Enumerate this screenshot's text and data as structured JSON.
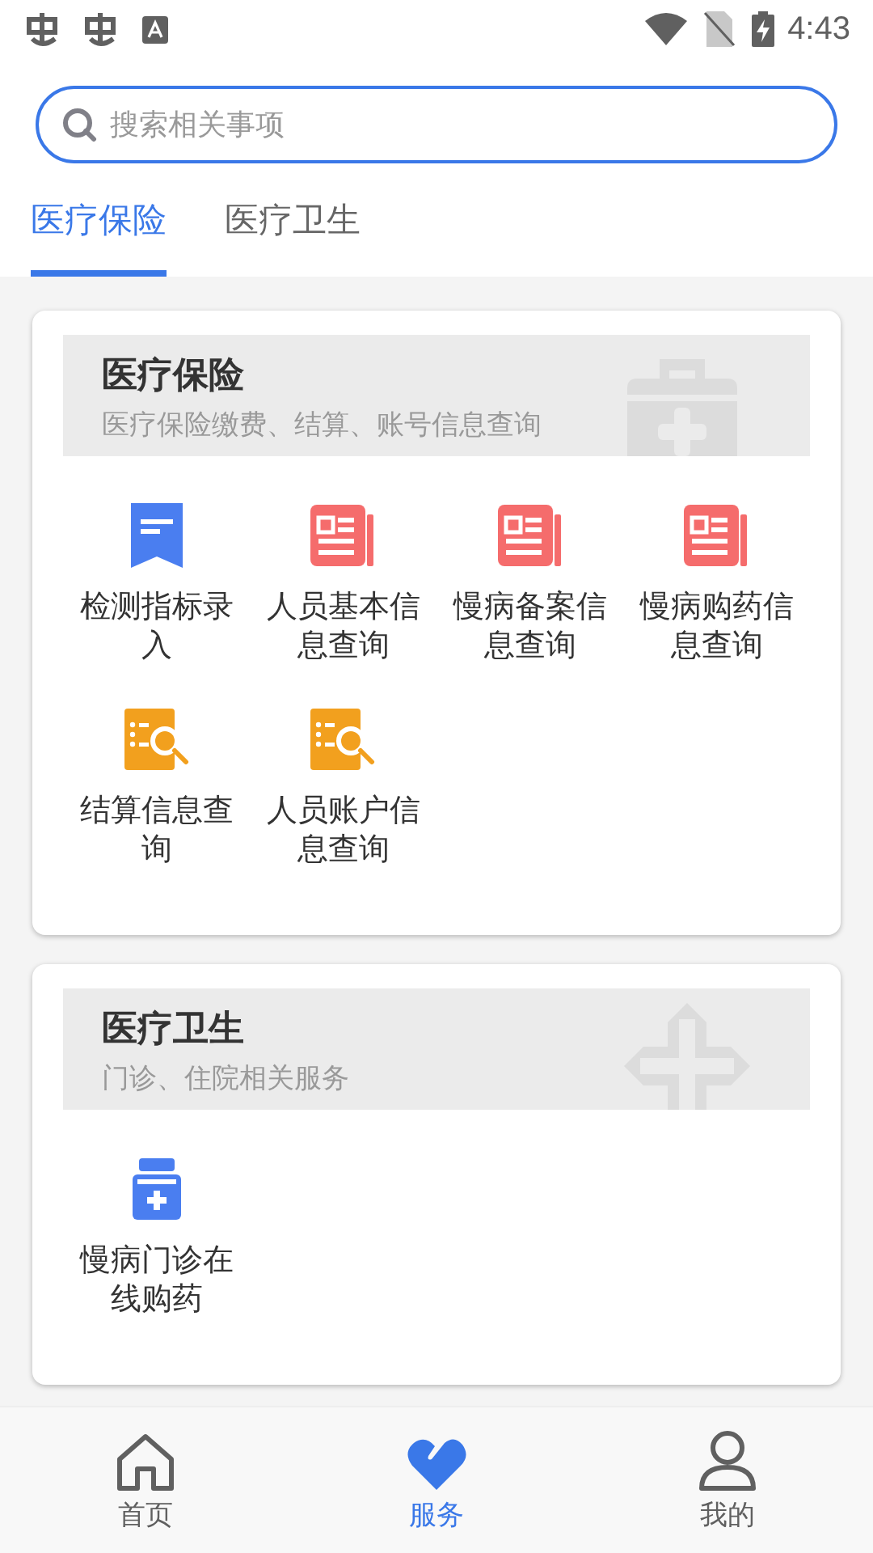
{
  "status_bar": {
    "time": "4:43"
  },
  "search": {
    "placeholder": "搜索相关事项"
  },
  "tabs": [
    {
      "label": "医疗保险",
      "selected": true
    },
    {
      "label": "医疗卫生",
      "selected": false
    }
  ],
  "sections": [
    {
      "title": "医疗保险",
      "subtitle": "医疗保险缴费、结算、账号信息查询",
      "kind": "kit",
      "items": [
        {
          "label": "检测指标录入",
          "kind": "bookmark"
        },
        {
          "label": "人员基本信息查询",
          "kind": "news"
        },
        {
          "label": "慢病备案信息查询",
          "kind": "news"
        },
        {
          "label": "慢病购药信息查询",
          "kind": "news"
        },
        {
          "label": "结算信息查询",
          "kind": "search-doc"
        },
        {
          "label": "人员账户信息查询",
          "kind": "search-doc"
        }
      ]
    },
    {
      "title": "医疗卫生",
      "subtitle": "门诊、住院相关服务",
      "kind": "cross",
      "items": [
        {
          "label": "慢病门诊在线购药",
          "kind": "medicine"
        }
      ]
    }
  ],
  "bottom_nav": [
    {
      "label": "首页",
      "kind": "home",
      "selected": false
    },
    {
      "label": "服务",
      "kind": "heart",
      "selected": true
    },
    {
      "label": "我的",
      "kind": "user",
      "selected": false
    }
  ]
}
